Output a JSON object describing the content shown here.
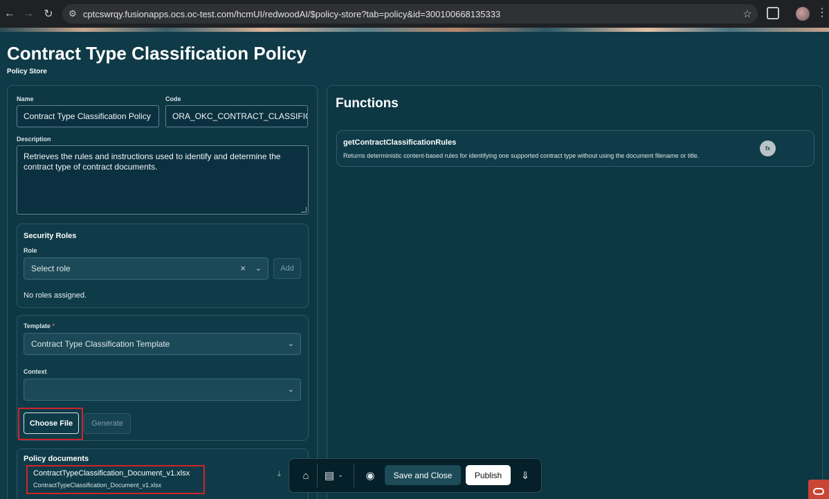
{
  "browser": {
    "url": "cptcswrqy.fusionapps.ocs.oc-test.com/hcmUI/redwoodAI/$policy-store?tab=policy&id=300100668135333"
  },
  "page": {
    "title": "Contract Type Classification Policy",
    "subtitle": "Policy Store"
  },
  "form": {
    "name_label": "Name",
    "name_value": "Contract Type Classification Policy",
    "code_label": "Code",
    "code_value": "ORA_OKC_CONTRACT_CLASSIFICAT",
    "description_label": "Description",
    "description_value": "Retrieves the rules and instructions used to identify and determine the contract type of contract documents."
  },
  "security_roles": {
    "title": "Security Roles",
    "role_label": "Role",
    "role_placeholder": "Select role",
    "add_label": "Add",
    "empty_text": "No roles assigned."
  },
  "template": {
    "label": "Template",
    "required_mark": "*",
    "value": "Contract Type Classification Template",
    "context_label": "Context",
    "context_value": "",
    "choose_file_label": "Choose File",
    "generate_label": "Generate"
  },
  "policy_documents": {
    "title": "Policy documents",
    "file_name": "ContractTypeClassification_Document_v1.xlsx",
    "file_sub": "ContractTypeClassification_Document_v1.xlsx"
  },
  "functions": {
    "title": "Functions",
    "items": [
      {
        "name": "getContractClassificationRules",
        "description": "Returns deterministic content-based rules for identifying one supported contract type without using the document filename or title.",
        "badge": "fx"
      }
    ]
  },
  "toolbar": {
    "save_close_label": "Save and Close",
    "publish_label": "Publish"
  },
  "icons": {
    "back": "arrow-left-icon",
    "forward": "arrow-right-icon",
    "reload": "reload-icon",
    "site_settings": "tune-icon",
    "bookmark": "star-icon",
    "extensions": "puzzle-icon",
    "home": "home-icon",
    "stack": "stack-icon",
    "palette": "palette-icon",
    "expand": "double-chevron-down-icon",
    "download": "download-icon"
  },
  "colors": {
    "background": "#0f3a47",
    "panel": "#0e3744",
    "highlight_box": "#d2232a",
    "oracle_brand": "#c74634"
  }
}
